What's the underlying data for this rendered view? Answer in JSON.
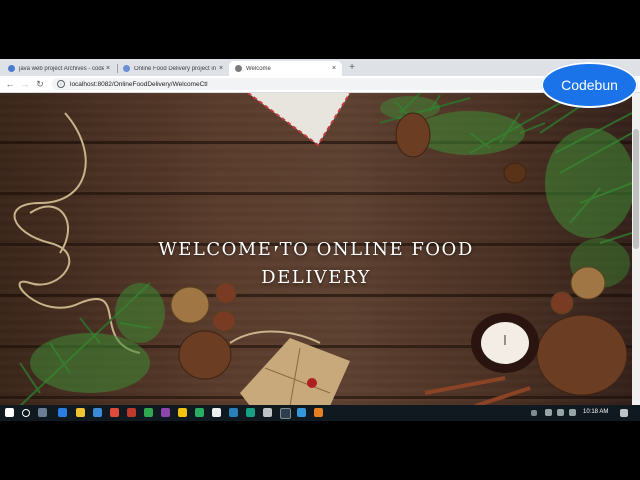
{
  "browser": {
    "tabs": [
      {
        "title": "java web project Archives - code",
        "fav_color": "#4a7bd0",
        "active": false
      },
      {
        "title": "Online Food Delivery project in J",
        "fav_color": "#6a8fd8",
        "active": false
      },
      {
        "title": "Welcome",
        "fav_color": "#7a7a7a",
        "active": true
      }
    ],
    "new_tab_label": "+",
    "close_glyph": "×",
    "url": "localhost:8082/OnlineFoodDelivery/WelcomeCtl",
    "back_glyph": "←",
    "forward_glyph": "→",
    "reload_glyph": "↻",
    "info_glyph": "i"
  },
  "page": {
    "welcome_line1": "WELCOME TO ONLINE FOOD",
    "welcome_line2": "DELIVERY"
  },
  "badge": {
    "label": "Codebun"
  },
  "taskbar": {
    "time": "10:18 AM"
  }
}
